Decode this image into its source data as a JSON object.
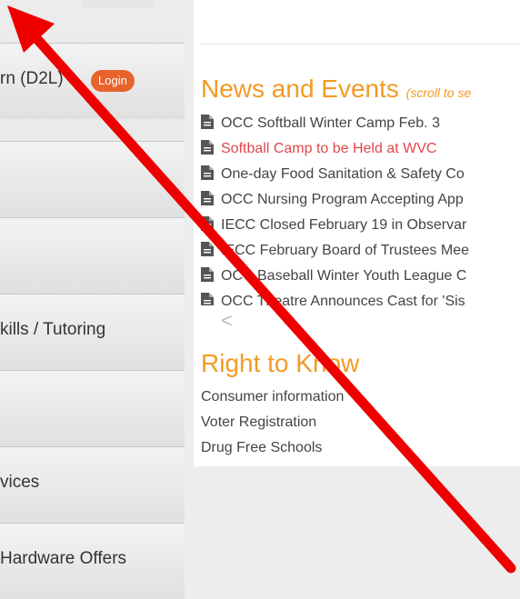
{
  "sidebar": {
    "items": [
      {
        "label": "rn (D2L)"
      },
      {
        "label": ""
      },
      {
        "label": ""
      },
      {
        "label": "kills / Tutoring"
      },
      {
        "label": ""
      },
      {
        "label": "vices"
      },
      {
        "label": "Hardware Offers"
      }
    ],
    "login_label": "Login"
  },
  "news": {
    "title": "News and Events",
    "hint": "(scroll to se",
    "items": [
      "OCC Softball Winter Camp Feb. 3",
      "Softball Camp to be Held at WVC",
      "One-day Food Sanitation & Safety Co",
      "OCC Nursing Program Accepting App",
      "IECC Closed February 19 in Observar",
      "IECC February Board of Trustees Mee",
      "OCC Baseball Winter Youth League C",
      "OCC Theatre Announces Cast for 'Sis"
    ],
    "prev_symbol": "<"
  },
  "right_to_know": {
    "title": "Right to Know",
    "links": [
      "Consumer information",
      "Voter Registration",
      "Drug Free Schools"
    ]
  },
  "colors": {
    "accent": "#f39a24",
    "highlight_link": "#e0474c",
    "login": "#e8632b",
    "arrow": "#ee0000"
  }
}
